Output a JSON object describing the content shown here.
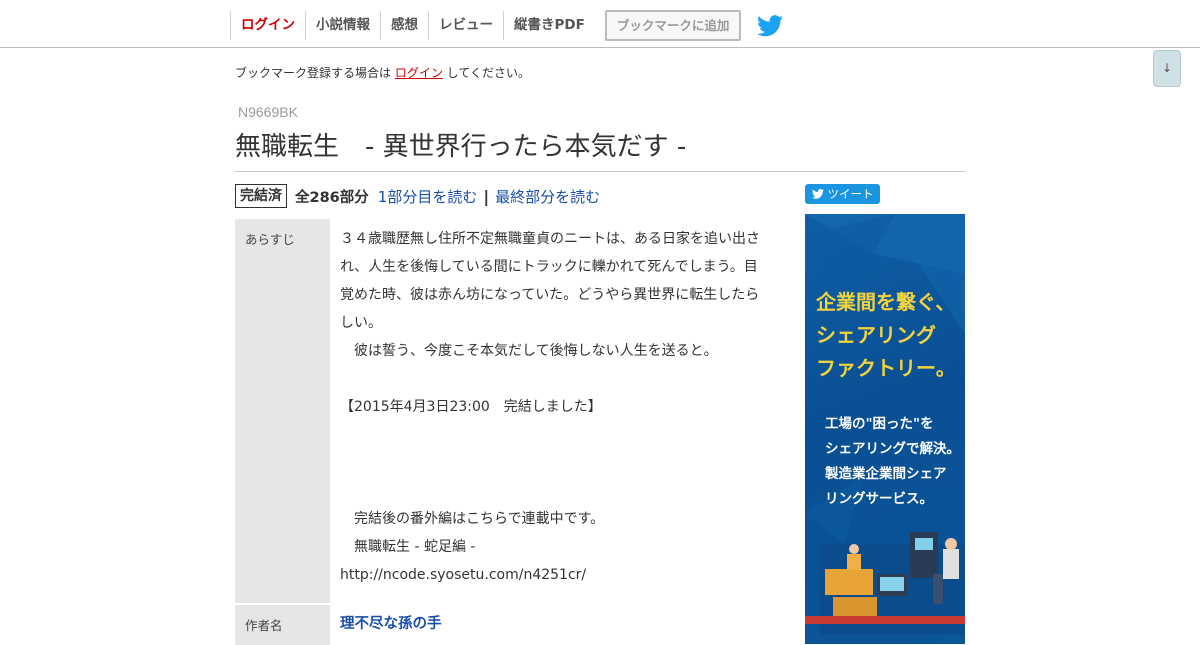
{
  "nav": {
    "items": [
      {
        "label": "ログイン"
      },
      {
        "label": "小説情報"
      },
      {
        "label": "感想"
      },
      {
        "label": "レビュー"
      },
      {
        "label": "縦書きPDF"
      }
    ],
    "bookmark_button": "ブックマークに追加"
  },
  "scroll_button": "↓",
  "notice": {
    "before": "ブックマーク登録する場合は",
    "link": "ログイン",
    "after": "してください。"
  },
  "novel": {
    "ncode": "N9669BK",
    "title": "無職転生　- 異世界行ったら本気だす -",
    "status": "完結済",
    "episodes": "全286部分",
    "first_link": "1部分目を読む",
    "separator": "|",
    "last_link": "最終部分を読む",
    "tweet": "ツイート",
    "synopsis_label": "あらすじ",
    "synopsis_lines": [
      "３４歳職歴無し住所不定無職童貞のニートは、ある日家を追い出さ",
      "れ、人生を後悔している間にトラックに轢かれて死んでしまう。目",
      "覚めた時、彼は赤ん坊になっていた。どうやら異世界に転生したら",
      "しい。",
      "　彼は誓う、今度こそ本気だして後悔しない人生を送ると。",
      "",
      "【2015年4月3日23:00　完結しました】",
      "",
      "",
      "",
      "　完結後の番外編はこちらで連載中です。",
      "　無職転生 - 蛇足編 -",
      "http://ncode.syosetu.com/n4251cr/"
    ],
    "author_label": "作者名",
    "author_name": "理不尽な孫の手"
  },
  "ad": {
    "headline": [
      "企業間を繋ぐ、",
      "シェアリング",
      "ファクトリー。"
    ],
    "body": [
      "工場の\"困った\"を",
      "シェアリングで解決。",
      "製造業企業間シェア",
      "リングサービス。"
    ]
  },
  "colors": {
    "login_red": "#cc0000",
    "link_blue": "#1a4fa8",
    "twitter_blue": "#1b95e0",
    "ad_yellow": "#f3d33b",
    "ad_blue": "#0b5599"
  }
}
